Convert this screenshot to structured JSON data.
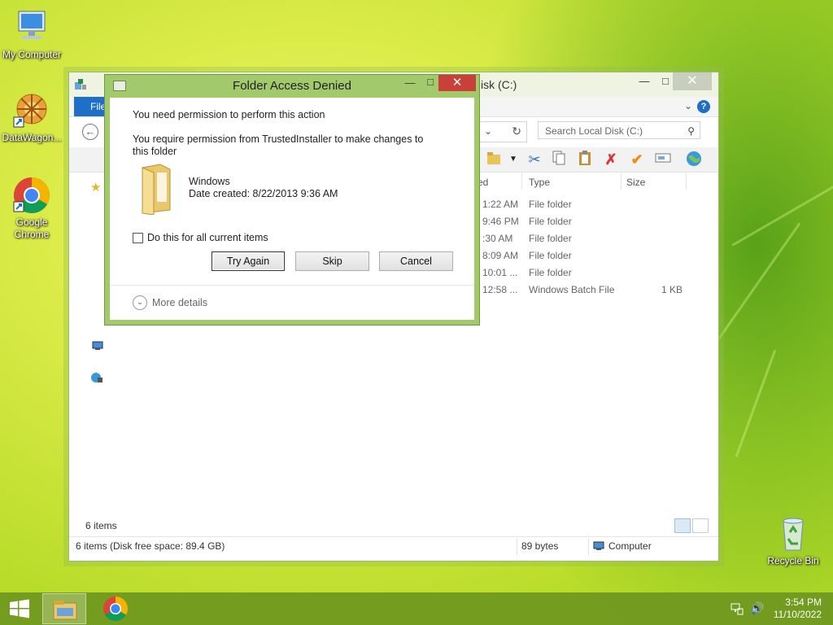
{
  "desktop": {
    "icons": [
      {
        "label": "My Computer"
      },
      {
        "label": "DataWagon..."
      },
      {
        "label": "Google Chrome"
      },
      {
        "label": "Recycle Bin"
      }
    ]
  },
  "explorer": {
    "title_fragment": "isk (C:)",
    "file_tab": "File",
    "search_placeholder": "Search Local Disk (C:)",
    "columns": {
      "modified_fragment": "ed",
      "type": "Type",
      "size": "Size"
    },
    "rows": [
      {
        "time": "1:22 AM",
        "type": "File folder",
        "size": ""
      },
      {
        "time": "9:46 PM",
        "type": "File folder",
        "size": ""
      },
      {
        "time": ":30 AM",
        "type": "File folder",
        "size": ""
      },
      {
        "time": "8:09 AM",
        "type": "File folder",
        "size": ""
      },
      {
        "time": "10:01 ...",
        "type": "File folder",
        "size": ""
      },
      {
        "time": "12:58 ...",
        "type": "Windows Batch File",
        "size": "1 KB"
      }
    ],
    "item_count": "6 items",
    "status": {
      "left": "6 items (Disk free space: 89.4 GB)",
      "size": "89 bytes",
      "location": "Computer"
    }
  },
  "dialog": {
    "title": "Folder Access Denied",
    "heading": "You need permission to perform this action",
    "message": "You require permission from TrustedInstaller to make changes to this folder",
    "item_name": "Windows",
    "item_date": "Date created: 8/22/2013 9:36 AM",
    "checkbox_label": "Do this for all current items",
    "buttons": {
      "try_again": "Try Again",
      "skip": "Skip",
      "cancel": "Cancel"
    },
    "more_details": "More details"
  },
  "taskbar": {
    "clock_time": "3:54 PM",
    "clock_date": "11/10/2022"
  },
  "colors": {
    "dialog_frame": "#a3c96d",
    "close_red": "#c9403a",
    "file_tab_blue": "#1e6fc7",
    "taskbar": "#6e961e"
  }
}
